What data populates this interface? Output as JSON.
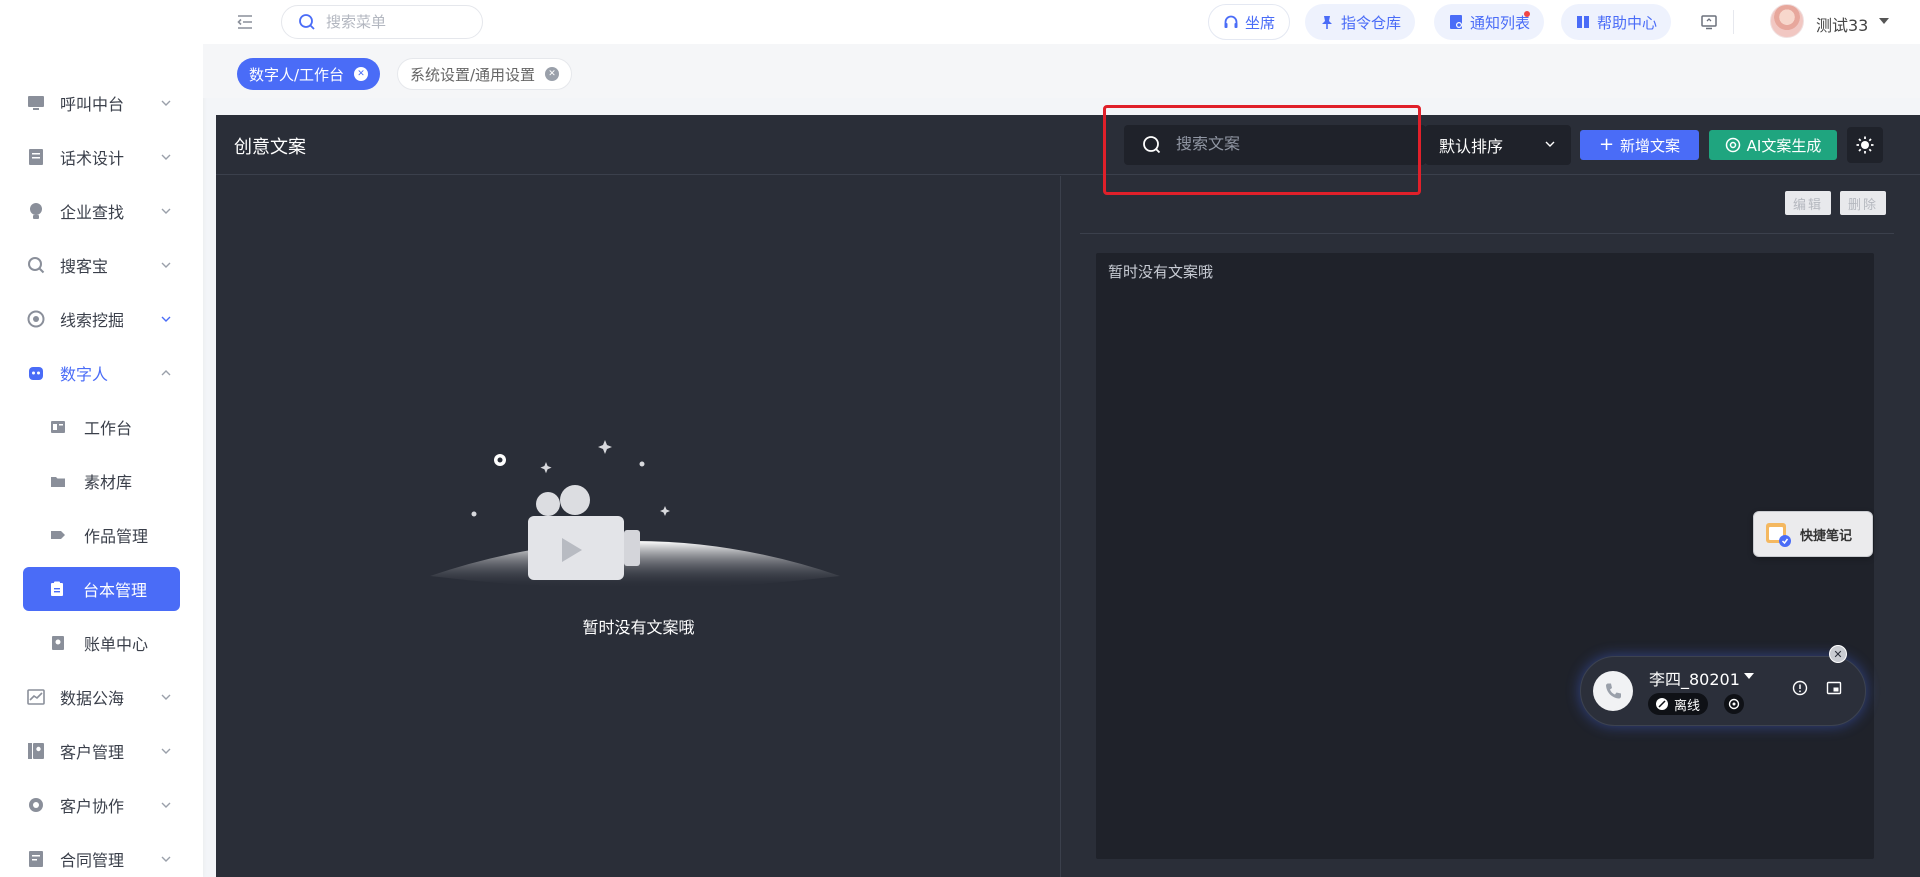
{
  "topbar": {
    "search_placeholder": "搜索菜单",
    "pills": [
      {
        "label": "坐席",
        "icon": "headset-icon"
      },
      {
        "label": "指令仓库",
        "icon": "pin-icon"
      },
      {
        "label": "通知列表",
        "icon": "notification-icon"
      },
      {
        "label": "帮助中心",
        "icon": "book-icon"
      }
    ],
    "user_name": "测试33"
  },
  "sidebar": {
    "items": [
      {
        "label": "呼叫中台",
        "icon": "monitor-icon"
      },
      {
        "label": "话术设计",
        "icon": "document-icon"
      },
      {
        "label": "企业查找",
        "icon": "bulb-icon"
      },
      {
        "label": "搜客宝",
        "icon": "search-zoom-icon"
      },
      {
        "label": "线索挖掘",
        "icon": "target-icon"
      },
      {
        "label": "数字人",
        "icon": "robot-icon"
      }
    ],
    "sub_items": [
      {
        "label": "工作台",
        "icon": "dashboard-icon"
      },
      {
        "label": "素材库",
        "icon": "folder-icon"
      },
      {
        "label": "作品管理",
        "icon": "tag-icon"
      },
      {
        "label": "台本管理",
        "icon": "clipboard-icon"
      },
      {
        "label": "账单中心",
        "icon": "bill-icon"
      }
    ],
    "items_after": [
      {
        "label": "数据公海",
        "icon": "chart-line-icon"
      },
      {
        "label": "客户管理",
        "icon": "contacts-icon"
      },
      {
        "label": "客户协作",
        "icon": "gear-icon"
      },
      {
        "label": "合同管理",
        "icon": "contract-icon"
      }
    ]
  },
  "tabs": [
    {
      "label": "数字人/工作台"
    },
    {
      "label": "系统设置/通用设置"
    }
  ],
  "main": {
    "title": "创意文案",
    "search_placeholder": "搜索文案",
    "sort_label": "默认排序",
    "add_button": "新增文案",
    "ai_button": "AI文案生成",
    "empty_text": "暂时没有文案哦",
    "edit_label": "编辑",
    "delete_label": "删除",
    "content_text": "暂时没有文案哦"
  },
  "widgets": {
    "quick_note": "快捷笔记",
    "agent_name": "李四_80201",
    "status": "离线"
  },
  "colors": {
    "accent": "#4a6cf7",
    "ai_green": "#1fa57f",
    "panel_dark": "#2a2e38",
    "highlight_red": "#e0202a"
  }
}
